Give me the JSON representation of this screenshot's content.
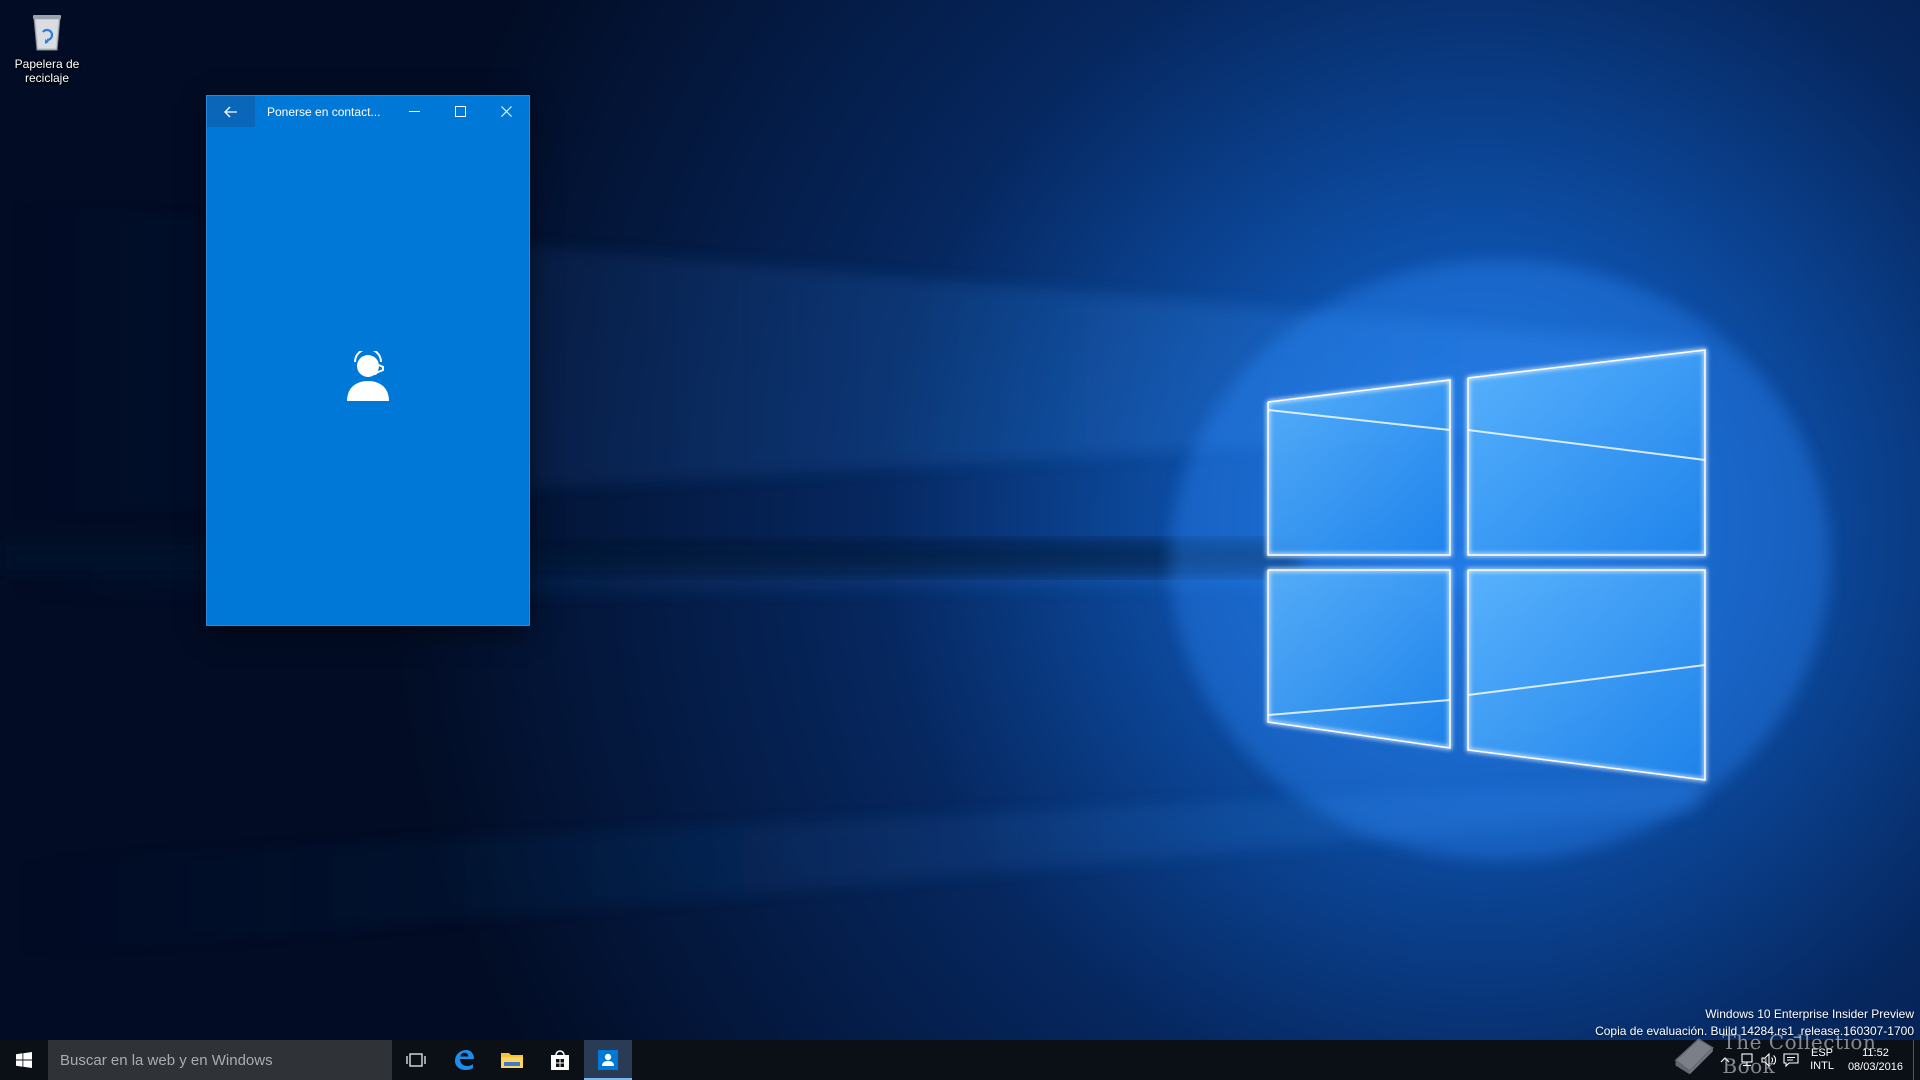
{
  "desktop": {
    "icons": [
      {
        "label": "Papelera de reciclaje",
        "icon": "recycle-bin-icon"
      }
    ]
  },
  "window": {
    "title": "Ponerse en contact...",
    "back_icon": "back-arrow-icon",
    "minimize_icon": "minimize-icon",
    "maximize_icon": "maximize-icon",
    "close_icon": "close-icon",
    "splash_icon": "support-agent-icon",
    "accent_color": "#0078d7"
  },
  "watermark": {
    "line1": "Windows 10 Enterprise Insider Preview",
    "line2": "Copia de evaluación. Build 14284.rs1_release.160307-1700"
  },
  "brand_watermark": {
    "text": "The Collection Book"
  },
  "taskbar": {
    "start_icon": "windows-start-icon",
    "search_placeholder": "Buscar en la web y en Windows",
    "pinned": [
      {
        "name": "task-view",
        "icon": "task-view-icon"
      },
      {
        "name": "edge",
        "icon": "edge-icon"
      },
      {
        "name": "file-explorer",
        "icon": "folder-icon"
      },
      {
        "name": "store",
        "icon": "store-icon"
      },
      {
        "name": "contact-support",
        "icon": "contact-support-icon",
        "active": true
      }
    ],
    "tray": {
      "language_top": "ESP",
      "language_bottom": "INTL",
      "time": "11:52",
      "date": "08/03/2016"
    }
  }
}
